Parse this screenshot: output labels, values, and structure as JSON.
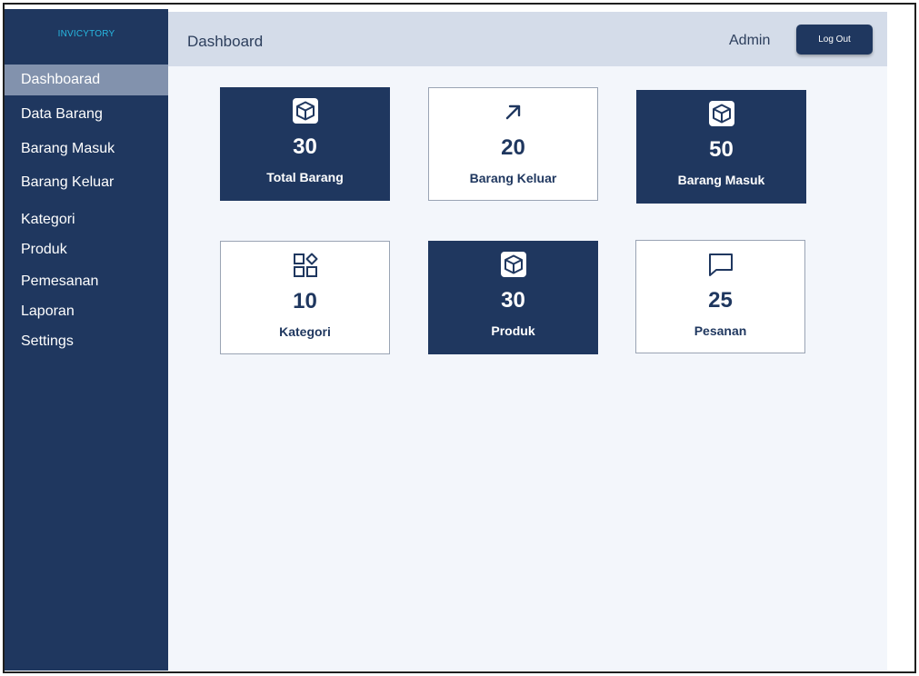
{
  "app": {
    "brand": "INVICYTORY"
  },
  "header": {
    "title": "Dashboard",
    "user": "Admin",
    "logout_label": "Log Out"
  },
  "sidebar": {
    "items": [
      {
        "label": "Dashboarad",
        "active": true
      },
      {
        "label": "Data Barang"
      },
      {
        "label": "Barang Masuk"
      },
      {
        "label": "Barang Keluar"
      },
      {
        "label": "Kategori"
      },
      {
        "label": "Produk"
      },
      {
        "label": "Pemesanan"
      },
      {
        "label": "Laporan"
      },
      {
        "label": "Settings"
      }
    ]
  },
  "cards": [
    {
      "value": "30",
      "label": "Total Barang",
      "icon": "box-icon"
    },
    {
      "value": "20",
      "label": "Barang Keluar",
      "icon": "arrow-up-right-icon"
    },
    {
      "value": "50",
      "label": "Barang Masuk",
      "icon": "box-icon"
    },
    {
      "value": "10",
      "label": "Kategori",
      "icon": "category-grid-icon"
    },
    {
      "value": "30",
      "label": "Produk",
      "icon": "box-icon"
    },
    {
      "value": "25",
      "label": "Pesanan",
      "icon": "message-icon"
    }
  ],
  "colors": {
    "primary": "#1f375f",
    "active_nav": "#8292ad",
    "topbar": "#d4dce9",
    "background": "#f3f6fb",
    "brand": "#27b7e0"
  }
}
